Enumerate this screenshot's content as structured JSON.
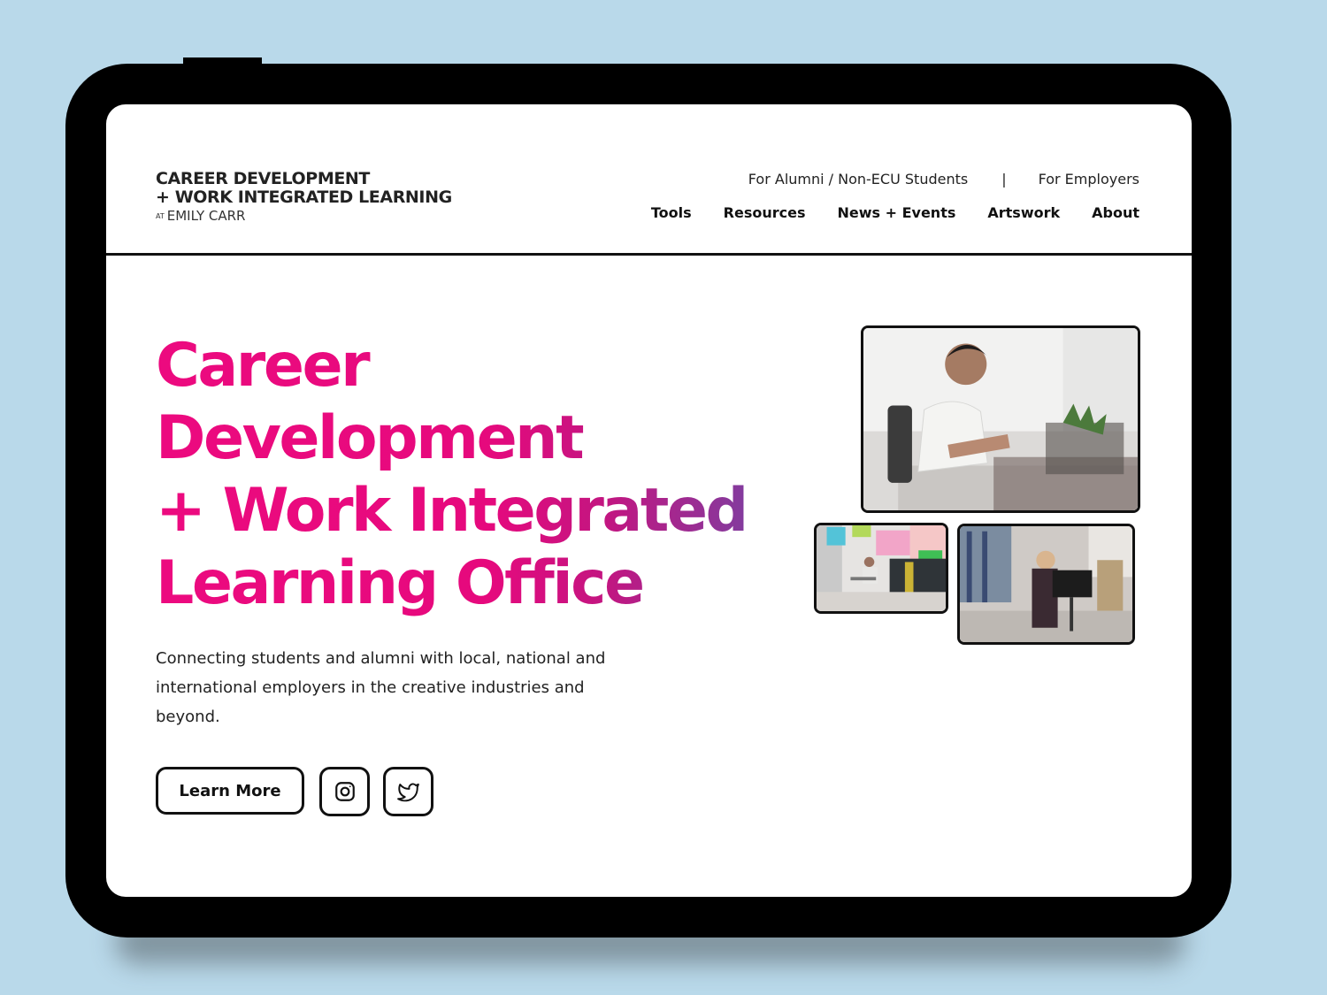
{
  "logo": {
    "line1": "CAREER DEVELOPMENT",
    "line2": "+ WORK INTEGRATED LEARNING",
    "at": "AT",
    "line3": "EMILY CARR"
  },
  "util_nav": {
    "alumni": "For Alumni / Non-ECU Students",
    "separator": "|",
    "employers": "For Employers"
  },
  "main_nav": [
    "Tools",
    "Resources",
    "News + Events",
    "Artswork",
    "About"
  ],
  "hero": {
    "title_lines": [
      "Career",
      "Development",
      "+ Work Integrated",
      "Learning Office"
    ],
    "subtitle": "Connecting students and alumni with local, national and international employers in the creative industries and beyond.",
    "learn_more": "Learn More"
  },
  "social": [
    "instagram-icon",
    "twitter-icon"
  ],
  "colors": {
    "background": "#b9d9ea",
    "accent_pink": "#ec0a7f",
    "accent_purple": "#7e3ea0",
    "frame": "#000000"
  }
}
